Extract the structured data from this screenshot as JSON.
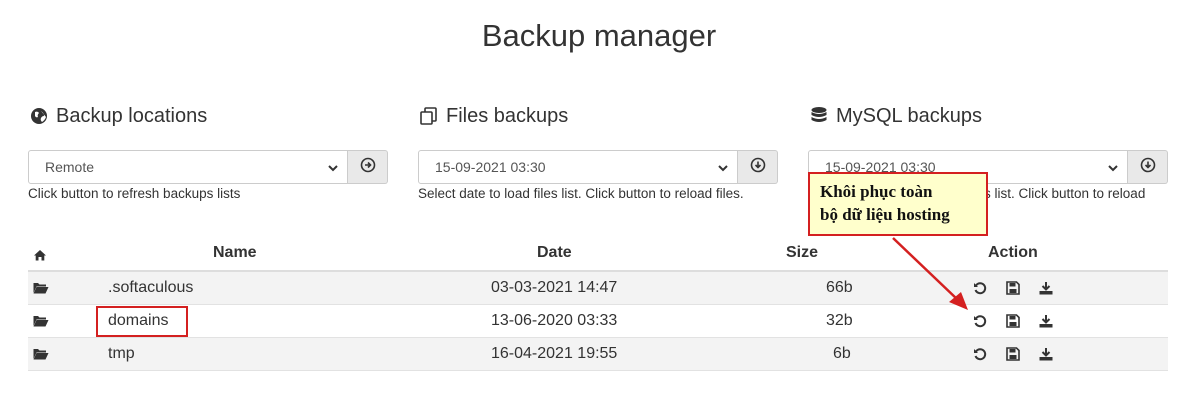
{
  "page": {
    "title": "Backup manager"
  },
  "locations": {
    "heading": "Backup locations",
    "icon": "globe-icon",
    "selected": "Remote",
    "button_icon": "refresh-circle-icon",
    "hint": "Click button to refresh backups lists"
  },
  "files": {
    "heading": "Files backups",
    "icon": "copy-icon",
    "selected": "15-09-2021 03:30",
    "button_icon": "download-circle-icon",
    "hint": "Select date to load files list. Click button to reload files."
  },
  "mysql": {
    "heading": "MySQL backups",
    "icon": "database-icon",
    "selected": "15-09-2021 03:30",
    "button_icon": "download-circle-icon",
    "hint_visible": "s list. Click button to reload"
  },
  "table": {
    "columns": {
      "name": "Name",
      "date": "Date",
      "size": "Size",
      "action": "Action"
    },
    "rows": [
      {
        "name": ".softaculous",
        "date": "03-03-2021 14:47",
        "size": "66b"
      },
      {
        "name": "domains",
        "date": "13-06-2020 03:33",
        "size": "32b"
      },
      {
        "name": "tmp",
        "date": "16-04-2021 19:55",
        "size": "6b"
      }
    ]
  },
  "annotation": {
    "callout_line1": "Khôi phục toàn",
    "callout_line2": "bộ dữ liệu hosting",
    "color": "#d42020",
    "callout_bg": "#ffffcc"
  }
}
